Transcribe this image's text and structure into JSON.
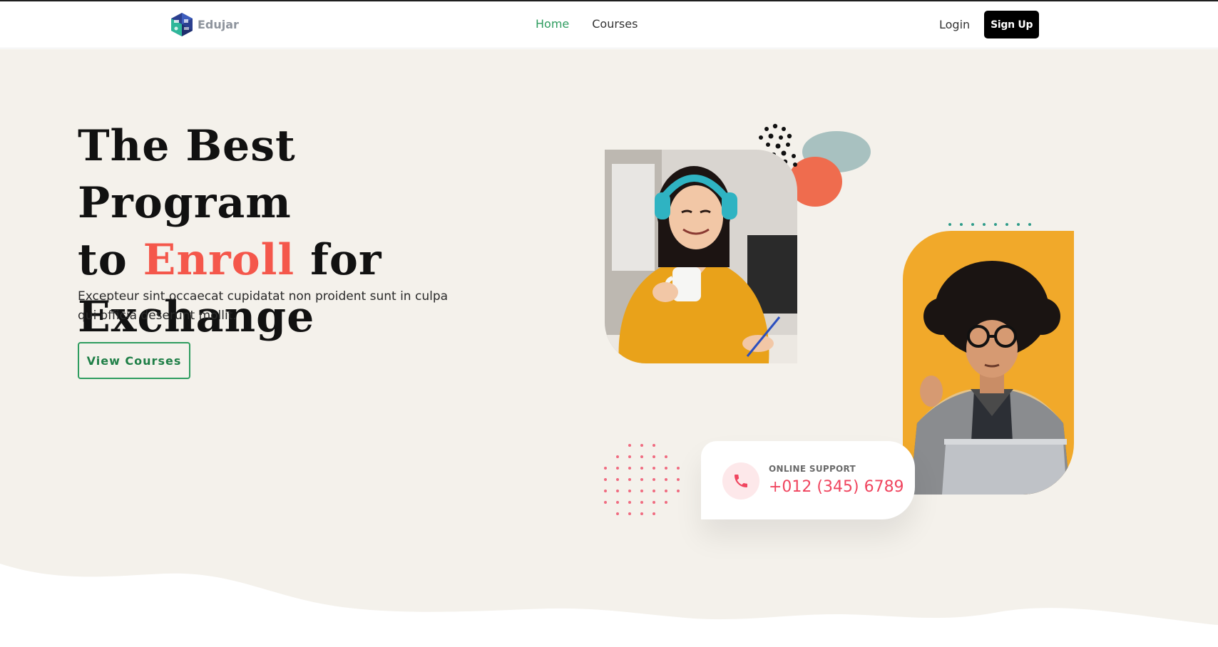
{
  "brand": {
    "name": "Edujar"
  },
  "nav": {
    "items": [
      {
        "label": "Home",
        "active": true
      },
      {
        "label": "Courses",
        "active": false
      }
    ],
    "login_label": "Login",
    "signup_label": "Sign Up"
  },
  "hero": {
    "title_line1": "The Best Program",
    "title_line2_prefix": "to ",
    "title_line2_accent": "Enroll",
    "title_line2_suffix": " for",
    "title_line3": "Exchange",
    "description": "Excepteur sint occaecat cupidatat non proident sunt in culpa qui officia deserunt mollit.",
    "cta_label": "View Courses"
  },
  "support": {
    "label": "ONLINE SUPPORT",
    "phone": "+012 (345) 6789"
  },
  "colors": {
    "accent_red": "#f4574b",
    "accent_green": "#2e9c5f",
    "hero_bg": "#f4f1eb",
    "phone_pink": "#f0455f"
  }
}
